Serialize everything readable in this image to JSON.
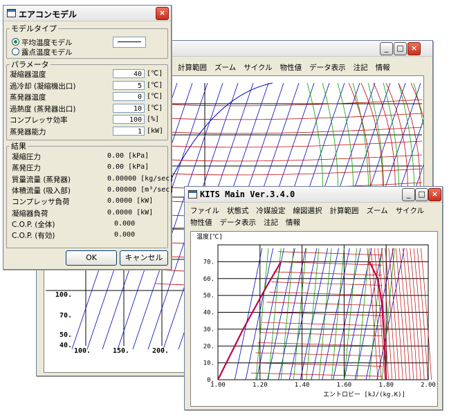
{
  "back_window": {
    "menu": [
      "計算範囲",
      "ズーム",
      "サイクル",
      "物性値",
      "データ表示",
      "注記",
      "情報"
    ],
    "y_ticks": [
      "100.",
      "70.",
      "50.",
      "40."
    ],
    "x_ticks": [
      "100.",
      "150.",
      "200."
    ]
  },
  "main_window": {
    "title": "KITS Main Ver.3.4.0",
    "menu_row1": [
      "ファイル",
      "状態式",
      "冷媒設定",
      "線図選択",
      "計算範囲",
      "ズーム",
      "サイクル"
    ],
    "menu_row2": [
      "物性値",
      "データ表示",
      "注記",
      "情報"
    ],
    "chart": {
      "ylabel": "温度[℃]",
      "xlabel": "エントロピー [kJ/(kg.K)]",
      "y_ticks": [
        "70.",
        "60.",
        "50.",
        "40.",
        "30.",
        "20.",
        "10.",
        "0."
      ],
      "x_ticks": [
        "1.00",
        "1.20",
        "1.40",
        "1.60",
        "1.80",
        "2.00"
      ]
    }
  },
  "chart_data": {
    "type": "line",
    "title": "",
    "xlabel": "エントロピー [kJ/(kg.K)]",
    "ylabel": "温度[℃]",
    "xlim": [
      1.0,
      2.0
    ],
    "ylim": [
      0,
      80
    ],
    "grid": true,
    "x_ticks": [
      1.0,
      1.2,
      1.4,
      1.6,
      1.8,
      2.0
    ],
    "y_ticks": [
      0,
      10,
      20,
      30,
      40,
      50,
      60,
      70
    ],
    "series": [
      {
        "color": "#c0004a",
        "x": [
          1.0,
          1.12,
          1.23,
          1.3
        ],
        "y": [
          0,
          30,
          55,
          70
        ]
      },
      {
        "color": "#c0004a",
        "x": [
          1.8,
          1.79,
          1.78,
          1.76,
          1.72
        ],
        "y": [
          0,
          25,
          45,
          60,
          70
        ]
      }
    ],
    "colors": {
      "isobar": "#c00000",
      "isochor": "#0000c0",
      "isenthalp": "#00a000",
      "quality": "#0000c0"
    }
  },
  "dialog": {
    "title": "エアコンモデル",
    "model_group": "モデルタイプ",
    "model_options": [
      "平均温度モデル",
      "露点温度モデル"
    ],
    "param_group": "パラメータ",
    "params": [
      {
        "label": "凝縮器温度",
        "value": "40",
        "unit": "[℃]"
      },
      {
        "label": "過冷却 (凝縮機出口)",
        "value": "5",
        "unit": "[℃]"
      },
      {
        "label": "蒸発器温度",
        "value": "0",
        "unit": "[℃]"
      },
      {
        "label": "過熱度 (蒸発器出口)",
        "value": "10",
        "unit": "[℃]"
      },
      {
        "label": "コンプレッサ効率",
        "value": "100",
        "unit": "[%]"
      },
      {
        "label": "蒸発器能力",
        "value": "1",
        "unit": "[kW]"
      }
    ],
    "result_group": "結果",
    "results": [
      {
        "label": "凝縮圧力",
        "value": "0.00 [kPa]"
      },
      {
        "label": "蒸発圧力",
        "value": "0.00 [kPa]"
      },
      {
        "label": "質量流量 (蒸発器)",
        "value": "0.00000 [kg/sec]"
      },
      {
        "label": "体積流量 (吸入部)",
        "value": "0.00000 [m³/sec]"
      },
      {
        "label": "コンプレッサ負荷",
        "value": "0.0000 [kW]"
      },
      {
        "label": "凝縮器負荷",
        "value": "0.0000 [kW]"
      },
      {
        "label": "C.O.P. (全体)",
        "value": "0.000"
      },
      {
        "label": "C.O.P. (有効)",
        "value": "0.000"
      }
    ],
    "ok_label": "OK",
    "cancel_label": "キャンセル"
  }
}
